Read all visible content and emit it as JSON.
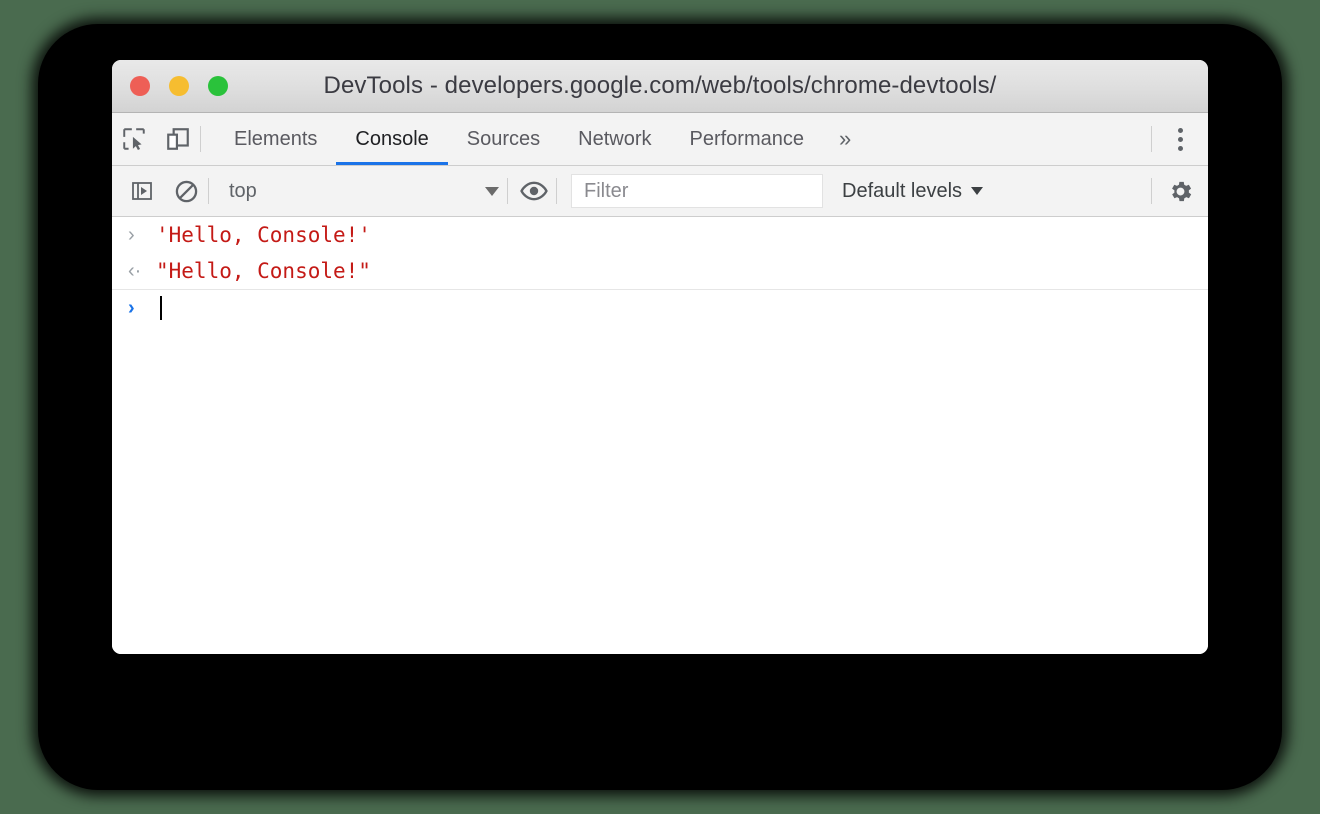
{
  "window": {
    "title": "DevTools - developers.google.com/web/tools/chrome-devtools/",
    "traffic_lights": [
      {
        "name": "close",
        "color": "#ee5f56"
      },
      {
        "name": "minimize",
        "color": "#f6bd30"
      },
      {
        "name": "zoom",
        "color": "#2ac23b"
      }
    ]
  },
  "toolbar": {
    "inspect_icon": "inspect-element-icon",
    "device_icon": "device-toolbar-icon",
    "overflow_label": "»",
    "menu_icon": "kebab-menu-icon"
  },
  "tabs": [
    {
      "label": "Elements",
      "active": false
    },
    {
      "label": "Console",
      "active": true
    },
    {
      "label": "Sources",
      "active": false
    },
    {
      "label": "Network",
      "active": false
    },
    {
      "label": "Performance",
      "active": false
    }
  ],
  "console_toolbar": {
    "sidebar_icon": "console-sidebar-icon",
    "clear_icon": "clear-console-icon",
    "context": "top",
    "eye_icon": "live-expression-icon",
    "filter_placeholder": "Filter",
    "filter_value": "",
    "levels_label": "Default levels",
    "settings_icon": "settings-gear-icon"
  },
  "console_rows": [
    {
      "gutter": "›",
      "gutter_style": "grey",
      "text": "'Hello, Console!'",
      "separator": false
    },
    {
      "gutter": "‹·",
      "gutter_style": "grey",
      "text": "\"Hello, Console!\"",
      "separator": true
    },
    {
      "gutter": "›",
      "gutter_style": "blue",
      "text": "",
      "separator": false
    }
  ],
  "colors": {
    "accent": "#1a73e8",
    "string": "#c41a16",
    "page_background": "#4a6b4f",
    "backdrop": "#000000"
  }
}
